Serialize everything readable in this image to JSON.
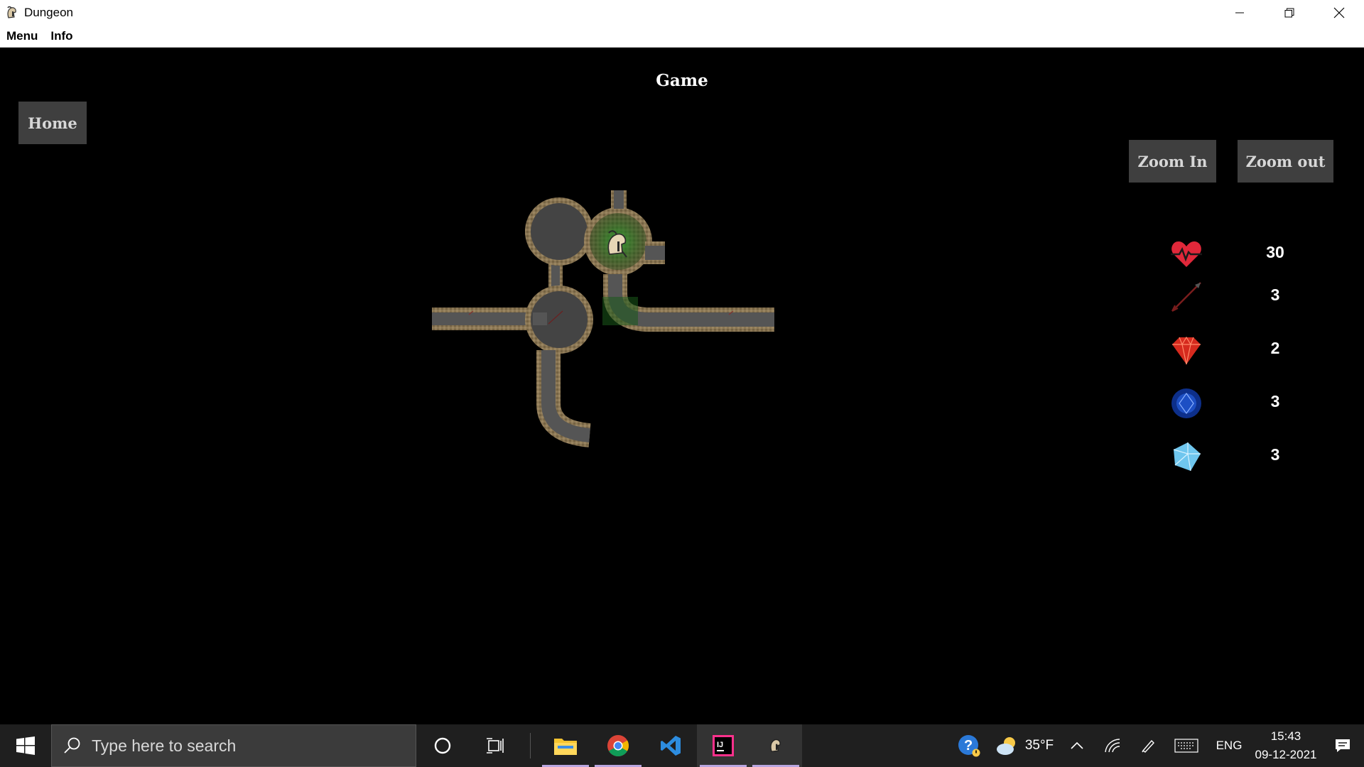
{
  "window": {
    "title": "Dungeon"
  },
  "menubar": {
    "items": [
      "Menu",
      "Info"
    ]
  },
  "game": {
    "title": "Game",
    "home_label": "Home",
    "zoom_in_label": "Zoom In",
    "zoom_out_label": "Zoom out"
  },
  "stats": [
    {
      "icon": "heart-health-icon",
      "value": "30"
    },
    {
      "icon": "arrow-icon",
      "value": "3"
    },
    {
      "icon": "ruby-icon",
      "value": "2"
    },
    {
      "icon": "sapphire-icon",
      "value": "3"
    },
    {
      "icon": "diamond-icon",
      "value": "3"
    }
  ],
  "taskbar": {
    "search_placeholder": "Type here to search",
    "weather": "35°F",
    "language": "ENG",
    "time": "15:43",
    "date": "09-12-2021"
  },
  "colors": {
    "background": "#000000",
    "button_bg": "#3f3f3f",
    "button_text": "#d7d7d7",
    "taskbar": "#1f1f1f",
    "health_red": "#e0283a"
  }
}
